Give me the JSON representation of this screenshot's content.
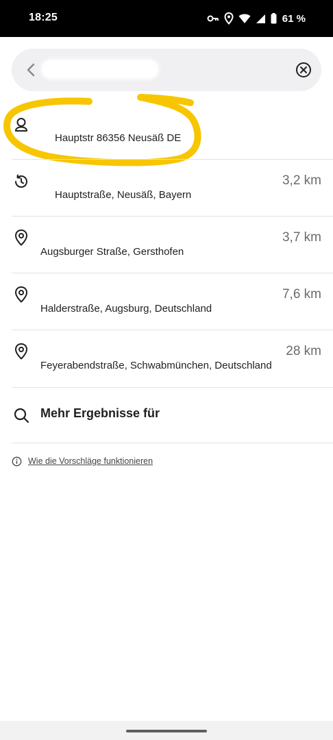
{
  "status_bar": {
    "time": "18:25",
    "battery": "61 %",
    "icons": [
      "vpn-key-icon",
      "location-icon",
      "wifi-icon",
      "cell-signal-icon",
      "battery-icon"
    ]
  },
  "search": {
    "value": "",
    "back_icon": "chevron-left-icon",
    "clear_icon": "clear-circle-icon"
  },
  "results": [
    {
      "icon": "contact-icon",
      "address": "Hauptstr 86356 Neusäß DE",
      "distance": ""
    },
    {
      "icon": "history-icon",
      "address": "Hauptstraße, Neusäß, Bayern",
      "distance": "3,2 km"
    },
    {
      "icon": "location-pin-icon",
      "address": "Augsburger Straße, Gersthofen",
      "distance": "3,7 km"
    },
    {
      "icon": "location-pin-icon",
      "address": "Halderstraße, Augsburg, Deutschland",
      "distance": "7,6 km"
    },
    {
      "icon": "location-pin-icon",
      "address": "Feyerabendstraße, Schwabmünchen, Deutschland",
      "distance": "28 km"
    }
  ],
  "more_results": {
    "label": "Mehr Ergebnisse für",
    "icon": "search-icon"
  },
  "info": {
    "label": "Wie die Vorschläge funktionieren",
    "icon": "info-icon"
  },
  "colors": {
    "highlight": "#f7c600",
    "distance": "#6b6b6b",
    "divider": "#e2e2e2",
    "search_bg": "#f0f0f3"
  }
}
